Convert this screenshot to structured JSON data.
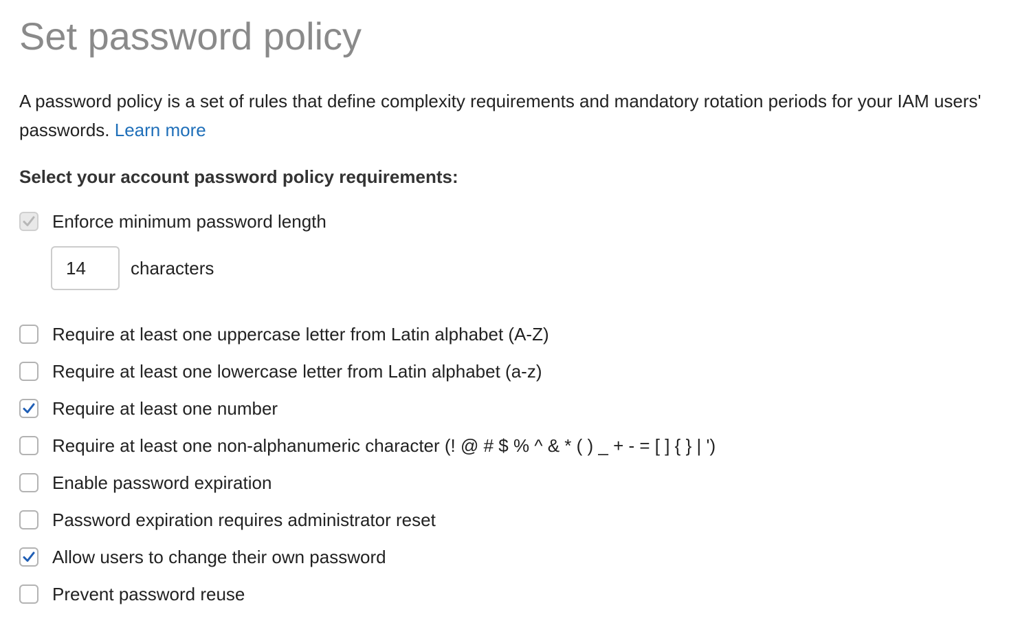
{
  "page": {
    "title": "Set password policy",
    "description": "A password policy is a set of rules that define complexity requirements and mandatory rotation periods for your IAM users' passwords.",
    "learn_more": "Learn more",
    "section_heading": "Select your account password policy requirements:"
  },
  "min_length": {
    "label": "Enforce minimum password length",
    "checked": true,
    "disabled": true,
    "value": "14",
    "unit": "characters"
  },
  "options": [
    {
      "label": "Require at least one uppercase letter from Latin alphabet (A-Z)",
      "checked": false
    },
    {
      "label": "Require at least one lowercase letter from Latin alphabet (a-z)",
      "checked": false
    },
    {
      "label": "Require at least one number",
      "checked": true
    },
    {
      "label": "Require at least one non-alphanumeric character (! @ # $ % ^ & * ( ) _ + - = [ ] { } | ')",
      "checked": false
    },
    {
      "label": "Enable password expiration",
      "checked": false
    },
    {
      "label": "Password expiration requires administrator reset",
      "checked": false
    },
    {
      "label": "Allow users to change their own password",
      "checked": true
    },
    {
      "label": "Prevent password reuse",
      "checked": false
    }
  ],
  "colors": {
    "title": "#8a8a8a",
    "link": "#1f6fb9",
    "check": "#1f5eb5"
  }
}
